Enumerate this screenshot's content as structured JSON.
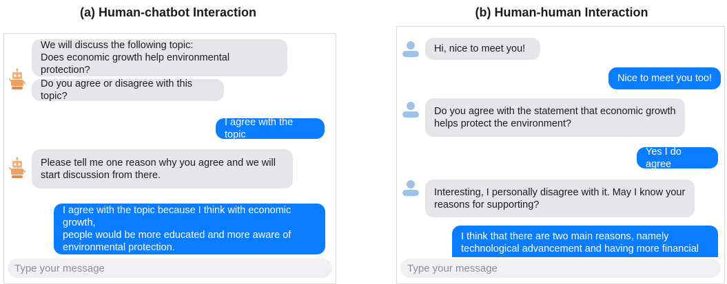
{
  "panel_a": {
    "title": "(a) Human-chatbot Interaction",
    "messages": [
      {
        "from": "bot",
        "text": "We will discuss the following topic:\nDoes economic growth help environmental protection?"
      },
      {
        "from": "bot",
        "text": "Do you agree or disagree with this topic?"
      },
      {
        "from": "user",
        "text": "I agree with the topic"
      },
      {
        "from": "bot",
        "text": "Please tell me one reason why you agree and we will\nstart discussion from there."
      },
      {
        "from": "user",
        "text": "I agree with the topic because I think with economic growth,\npeople would be more educated and more aware of\nenvironmental protection."
      }
    ],
    "input_placeholder": "Type your message"
  },
  "panel_b": {
    "title": "(b) Human-human Interaction",
    "messages": [
      {
        "from": "partner",
        "text": "Hi, nice to meet you!"
      },
      {
        "from": "user",
        "text": "Nice to meet you too!"
      },
      {
        "from": "partner",
        "text": "Do you agree with the statement that economic growth\nhelps protect the environment?"
      },
      {
        "from": "user",
        "text": "Yes I do agree"
      },
      {
        "from": "partner",
        "text": "Interesting, I personally disagree with it. May I know your\nreasons for supporting?"
      },
      {
        "from": "user",
        "text": "I think that there are two main reasons, namely\ntechnological advancement and having more financial"
      }
    ],
    "input_placeholder": "Type your message"
  },
  "colors": {
    "outgoing_bubble": "#0a7cff",
    "incoming_bubble": "#e6e6ea",
    "robot_icon": "#f0a060",
    "person_icon": "#9fc3e7"
  },
  "icons": {
    "bot": "robot-icon",
    "partner": "person-avatar-icon"
  }
}
